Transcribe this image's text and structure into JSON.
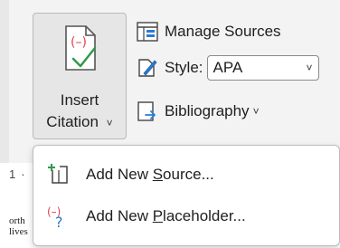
{
  "ribbon": {
    "insert_citation": {
      "line1": "Insert",
      "line2": "Citation",
      "chevron": "˅"
    },
    "manage_sources": {
      "label": "Manage Sources"
    },
    "style": {
      "label": "Style:",
      "value": "APA",
      "chevron": "˅"
    },
    "bibliography": {
      "label": "Bibliography",
      "chevron": "˅"
    }
  },
  "document": {
    "ruler_number": "1",
    "ruler_mark": "·",
    "text_line1": "orth",
    "text_line2": "lives"
  },
  "menu": {
    "add_new_source": {
      "pre": "Add New ",
      "accel": "S",
      "post": "ource..."
    },
    "add_new_placeholder": {
      "pre": "Add New ",
      "accel": "P",
      "post": "laceholder..."
    }
  },
  "colors": {
    "accent_red": "#e0434d",
    "accent_green": "#2e9b4b",
    "accent_blue": "#2b7cd3"
  }
}
